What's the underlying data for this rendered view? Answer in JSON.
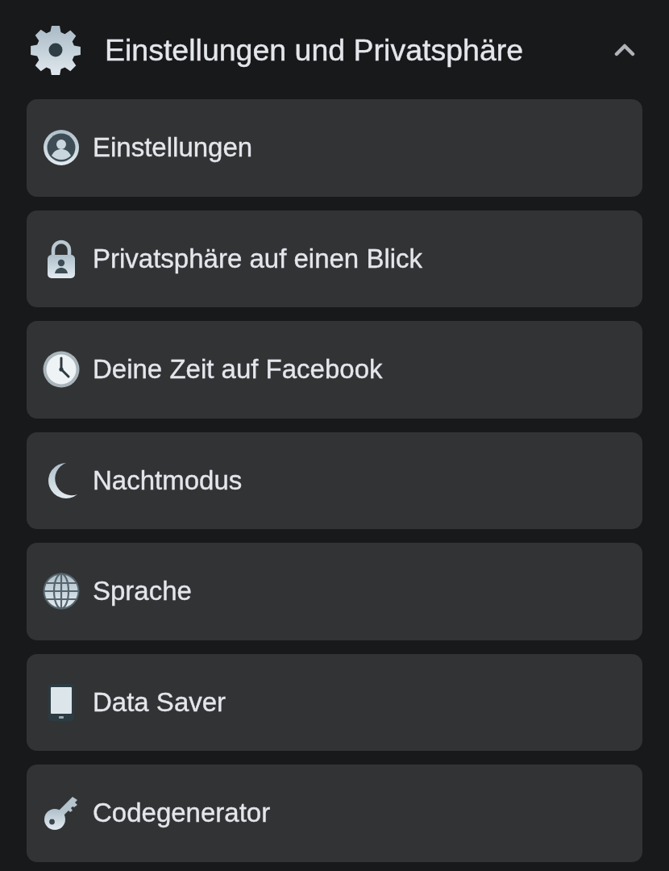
{
  "section": {
    "title": "Einstellungen und Privatsphäre",
    "expanded": true
  },
  "items": [
    {
      "label": "Einstellungen"
    },
    {
      "label": "Privatsphäre auf einen Blick"
    },
    {
      "label": "Deine Zeit auf Facebook"
    },
    {
      "label": "Nachtmodus"
    },
    {
      "label": "Sprache"
    },
    {
      "label": "Data Saver"
    },
    {
      "label": "Codegenerator"
    }
  ]
}
